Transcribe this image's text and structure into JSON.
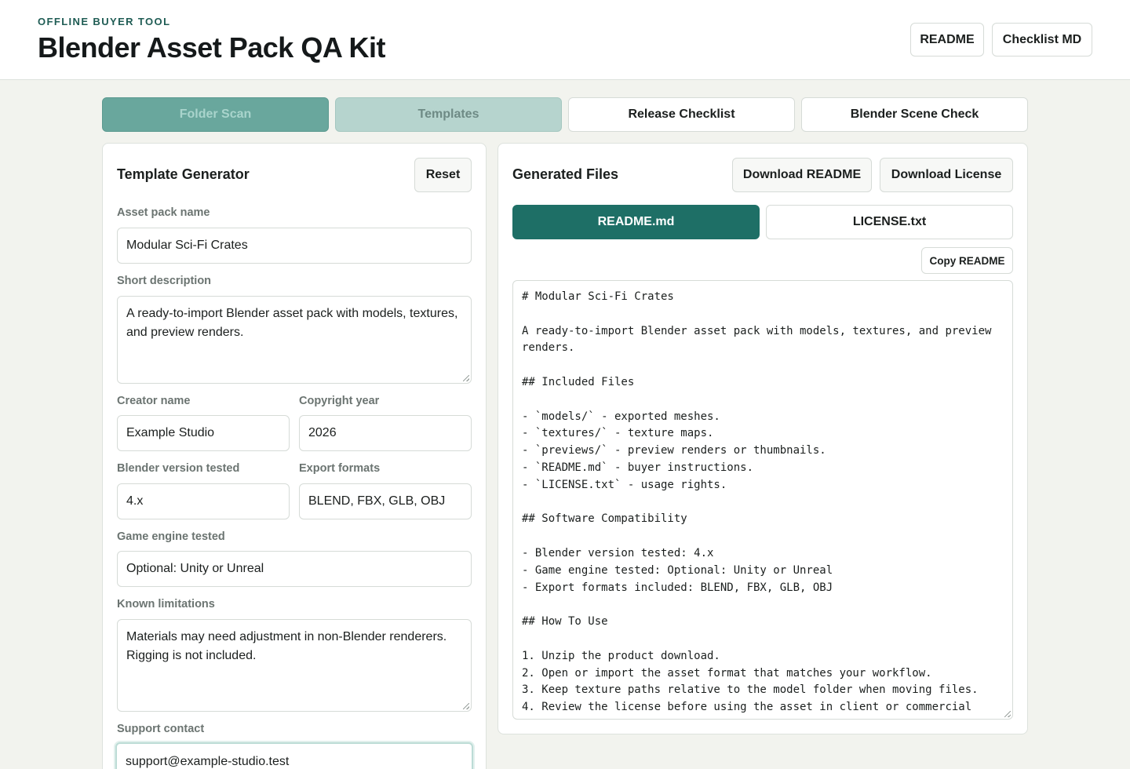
{
  "header": {
    "eyebrow": "OFFLINE BUYER TOOL",
    "title": "Blender Asset Pack QA Kit",
    "buttons": {
      "readme": "README",
      "checklist_md": "Checklist MD"
    }
  },
  "tabs": [
    {
      "label": "Folder Scan"
    },
    {
      "label": "Templates"
    },
    {
      "label": "Release Checklist"
    },
    {
      "label": "Blender Scene Check"
    }
  ],
  "generator": {
    "title": "Template Generator",
    "reset_label": "Reset",
    "asset_pack_name": {
      "label": "Asset pack name",
      "value": "Modular Sci-Fi Crates"
    },
    "short_description": {
      "label": "Short description",
      "value": "A ready-to-import Blender asset pack with models, textures, and preview renders."
    },
    "creator_name": {
      "label": "Creator name",
      "value": "Example Studio"
    },
    "copyright_year": {
      "label": "Copyright year",
      "value": "2026"
    },
    "blender_version": {
      "label": "Blender version tested",
      "value": "4.x"
    },
    "export_formats": {
      "label": "Export formats",
      "value": "BLEND, FBX, GLB, OBJ"
    },
    "game_engine": {
      "label": "Game engine tested",
      "value": "Optional: Unity or Unreal"
    },
    "known_limitations": {
      "label": "Known limitations",
      "value": "Materials may need adjustment in non-Blender renderers. Rigging is not included."
    },
    "support_contact": {
      "label": "Support contact",
      "value": "support@example-studio.test"
    }
  },
  "output": {
    "title": "Generated Files",
    "download_readme": "Download README",
    "download_license": "Download License",
    "file_tabs": {
      "readme": "README.md",
      "license": "LICENSE.txt"
    },
    "copy_label": "Copy README",
    "readme_text": "# Modular Sci-Fi Crates\n\nA ready-to-import Blender asset pack with models, textures, and preview renders.\n\n## Included Files\n\n- `models/` - exported meshes.\n- `textures/` - texture maps.\n- `previews/` - preview renders or thumbnails.\n- `README.md` - buyer instructions.\n- `LICENSE.txt` - usage rights.\n\n## Software Compatibility\n\n- Blender version tested: 4.x\n- Game engine tested: Optional: Unity or Unreal\n- Export formats included: BLEND, FBX, GLB, OBJ\n\n## How To Use\n\n1. Unzip the product download.\n2. Open or import the asset format that matches your workflow.\n3. Keep texture paths relative to the model folder when moving files.\n4. Review the license before using the asset in client or commercial"
  },
  "colors": {
    "accent": "#1e6f66",
    "eyebrow": "#1f5c54",
    "background": "#f2f3ee"
  }
}
